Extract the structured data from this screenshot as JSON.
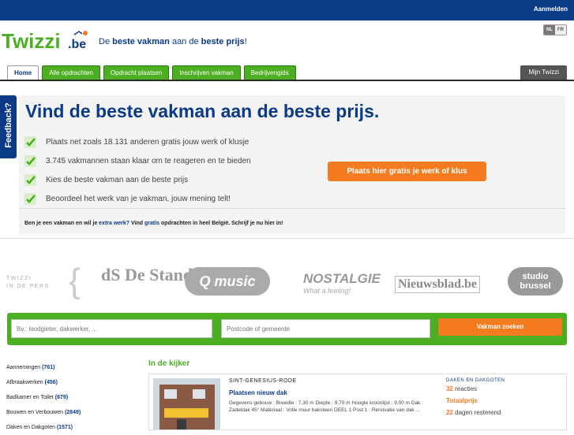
{
  "topbar": {
    "login": "Aanmelden"
  },
  "brand": {
    "name": "Twizzi.be",
    "tagline_pre": "De ",
    "tagline_b1": "beste vakman",
    "tagline_mid": " aan de ",
    "tagline_b2": "beste prijs",
    "tagline_end": "!",
    "languages": [
      "NL",
      "FR"
    ]
  },
  "nav": {
    "tabs": [
      "Home",
      "Alle opdrachten",
      "Opdracht plaatsen",
      "Inschrijven vakman",
      "Bedrijvengids"
    ],
    "my": "Mijn Twizzi"
  },
  "feedback": "Feedback?",
  "hero": {
    "title": "Vind de beste vakman aan de beste prijs.",
    "bullets": [
      "Plaats net zoals 18.131 anderen gratis jouw werk of klusje",
      "3.745 vakmannen staan klaar om te reageren en te bieden",
      "Kies de beste vakman aan de beste prijs",
      "Beoordeel het werk van je vakman, jouw mening telt!"
    ],
    "cta": "Plaats hier gratis je werk of klus",
    "promo_1": "Ben je een vakman en wil je ",
    "promo_link1": "extra werk?",
    "promo_2": " Vind ",
    "promo_link2": "gratis",
    "promo_3": " opdrachten in heel België. Schrijf je nu hier in!"
  },
  "press": {
    "label_1": "TWIZZI",
    "label_2": "IN DE PERS",
    "logos": [
      "dS De Standaard",
      "Q music",
      "NOSTALGIE",
      "What a feeling!",
      "Nieuwsblad.be",
      "studio brussel"
    ]
  },
  "search": {
    "what_placeholder": "Bv.: loodgieter, dakwerker, ...",
    "where_placeholder": "Postcode of gemeente",
    "button": "Vakman zoeken"
  },
  "categories": [
    {
      "name": "Aannemingen",
      "count": "(761)"
    },
    {
      "name": "Afbraakwerken",
      "count": "(456)"
    },
    {
      "name": "Badkamer en Toilet",
      "count": "(679)"
    },
    {
      "name": "Bouwen en Verbouwen",
      "count": "(2849)"
    },
    {
      "name": "Daken en Dakgoten",
      "count": "(1571)"
    }
  ],
  "featured": {
    "title": "In de kijker",
    "location": "SINT-GENESIUS-RODE",
    "job_title": "Plaatsen nieuw dak",
    "description": "Gegevens gebouw : Breedte : 7,30 m Diepte : 9,70 m Hoogte kroonlijst : 9,00 m Dak : Zadeldak 45° Materiaal : Volle muur baksteen DEEL 1 Post 1 : Renovatie van dak ...",
    "category": "DAKEN EN DAKGOTEN",
    "reactions_num": "32",
    "reactions_label": " reacties",
    "total_label": "Totaalprijs",
    "days_num": "22",
    "days_label": " dagen resterend"
  },
  "colors": {
    "navy": "#0b3a86",
    "green": "#4caf22",
    "orange": "#f47b20"
  }
}
